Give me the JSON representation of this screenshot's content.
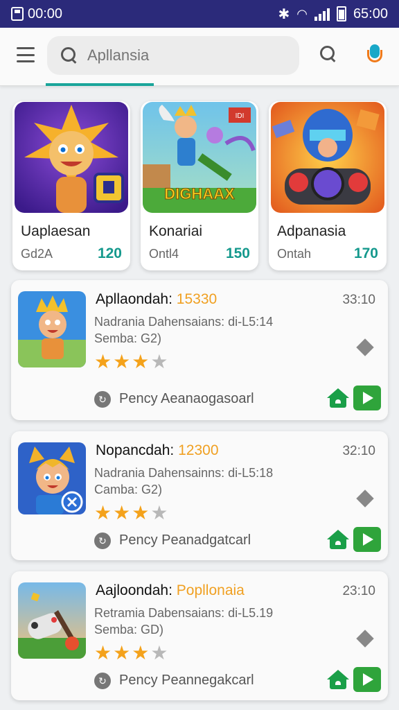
{
  "status_bar": {
    "left_time": "00:00",
    "right_time": "65:00"
  },
  "app_bar": {
    "search_placeholder": "Apllansia"
  },
  "featured": [
    {
      "title": "Uaplaesan",
      "sub": "Gd2A",
      "count": "120"
    },
    {
      "title": "Konariai",
      "sub": "Ontl4",
      "count": "150"
    },
    {
      "title": "Adpanasia",
      "sub": "Ontah",
      "count": "170"
    }
  ],
  "featured_art_labels": {
    "second": "DIGHAAX"
  },
  "list": [
    {
      "name": "Apllaondah:",
      "name_highlight": "15330",
      "time": "33:10",
      "desc_line1": "Nadrania Dahensaians: di-L5:14",
      "desc_line2": "Semba: G2)",
      "rating": 3,
      "footer": "Pency Aeanaogasoarl"
    },
    {
      "name": "Nopancdah:",
      "name_highlight": "12300",
      "time": "32:10",
      "desc_line1": "Nadrania Dahensainns: di-L5:18",
      "desc_line2": "Camba: G2)",
      "rating": 3,
      "footer": "Pency Peanadgatcarl"
    },
    {
      "name": "Aajloondah:",
      "name_highlight": "Popllonaia",
      "time": "23:10",
      "desc_line1": "Retramia Dabensaians: di-L5.19",
      "desc_line2": "Semba: GD)",
      "rating": 3,
      "footer": "Pency Peannegakcarl"
    }
  ],
  "colors": {
    "status_bar": "#2b2a7a",
    "accent_teal": "#15998d",
    "highlight_orange": "#f0a022",
    "star": "#f4a21b",
    "play_green": "#2fa43b"
  }
}
